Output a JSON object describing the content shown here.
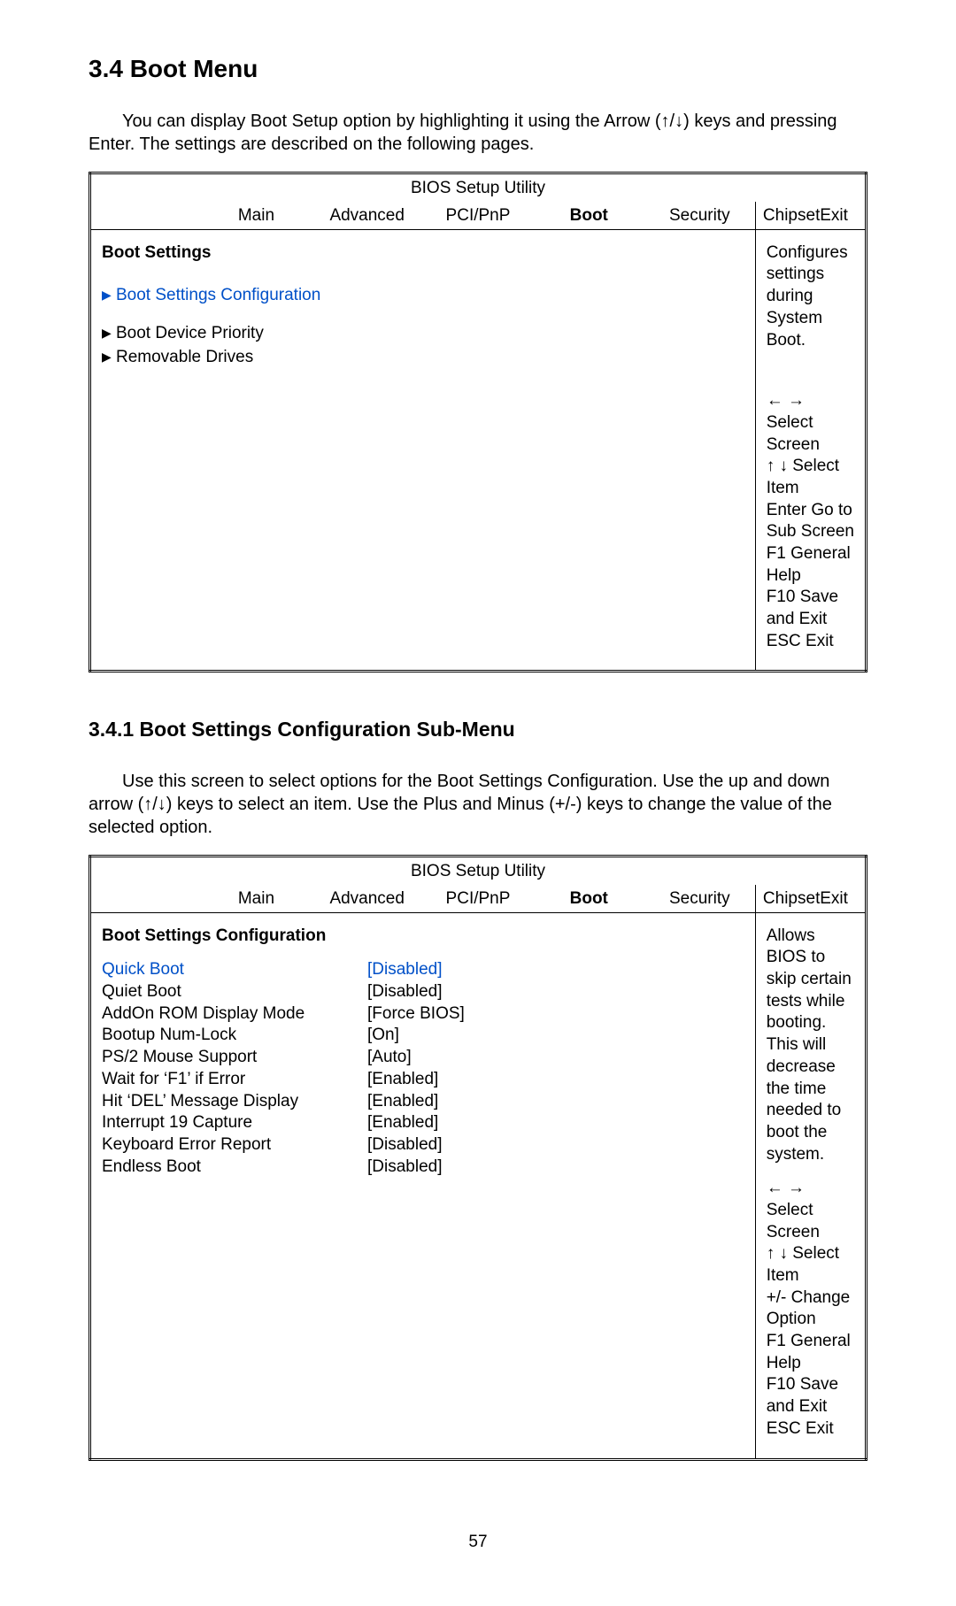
{
  "heading": "3.4 Boot Menu",
  "intro1": "You can display Boot Setup option by highlighting it using the Arrow (↑/↓) keys and pressing Enter.  The settings are described on the following pages.",
  "bios1": {
    "title": "BIOS Setup Utility",
    "nav": {
      "main": "Main",
      "advanced": "Advanced",
      "pcipnp": "PCI/PnP",
      "boot": "Boot",
      "security": "Security",
      "chipset": "Chipset",
      "exit": "Exit"
    },
    "left_title": "Boot Settings",
    "items": [
      "Boot Settings Configuration",
      "Boot Device Priority",
      "Removable Drives"
    ],
    "right_top": "Configures settings during System Boot.",
    "help": {
      "select_screen": "← → Select Screen",
      "select_item": "↑  ↓ Select Item",
      "enter": "Enter Go to Sub Screen",
      "f1": "F1     General Help",
      "f10": "F10   Save and Exit",
      "esc": "ESC  Exit"
    }
  },
  "subheading": "3.4.1 Boot Settings Configuration Sub-Menu",
  "intro2": "Use this screen to select options for the Boot Settings Configuration. Use the up and down arrow (↑/↓) keys to select an item. Use the Plus and Minus (+/-) keys to change the value of the selected option.",
  "bios2": {
    "title": "BIOS Setup Utility",
    "nav": {
      "main": "Main",
      "advanced": "Advanced",
      "pcipnp": "PCI/PnP",
      "boot": "Boot",
      "security": "Security",
      "chipset": "Chipset",
      "exit": "Exit"
    },
    "left_title": "Boot Settings Configuration",
    "rows": [
      {
        "label": "Quick Boot",
        "value": "[Disabled]",
        "blue": true
      },
      {
        "label": "Quiet Boot",
        "value": "[Disabled]"
      },
      {
        "label": "AddOn ROM Display Mode",
        "value": "[Force BIOS]"
      },
      {
        "label": "Bootup Num-Lock",
        "value": "[On]"
      },
      {
        "label": "PS/2 Mouse Support",
        "value": "[Auto]"
      },
      {
        "label": "Wait for ‘F1’ if Error",
        "value": "[Enabled]"
      },
      {
        "label": "Hit ‘DEL’ Message Display",
        "value": "[Enabled]"
      },
      {
        "label": "Interrupt 19 Capture",
        "value": "[Enabled]"
      },
      {
        "label": "",
        "value": ""
      },
      {
        "label": "Keyboard Error Report",
        "value": "[Disabled]"
      },
      {
        "label": "Endless Boot",
        "value": "[Disabled]"
      }
    ],
    "right_top": "Allows BIOS to skip certain tests while booting.  This will decrease the time needed to boot the system.",
    "help": {
      "select_screen": "← → Select Screen",
      "select_item": "↑  ↓  Select Item",
      "plusminus": "+/-    Change Option",
      "f1": "F1     General Help",
      "f10": "F10   Save and Exit",
      "esc": "ESC  Exit"
    }
  },
  "page": "57"
}
